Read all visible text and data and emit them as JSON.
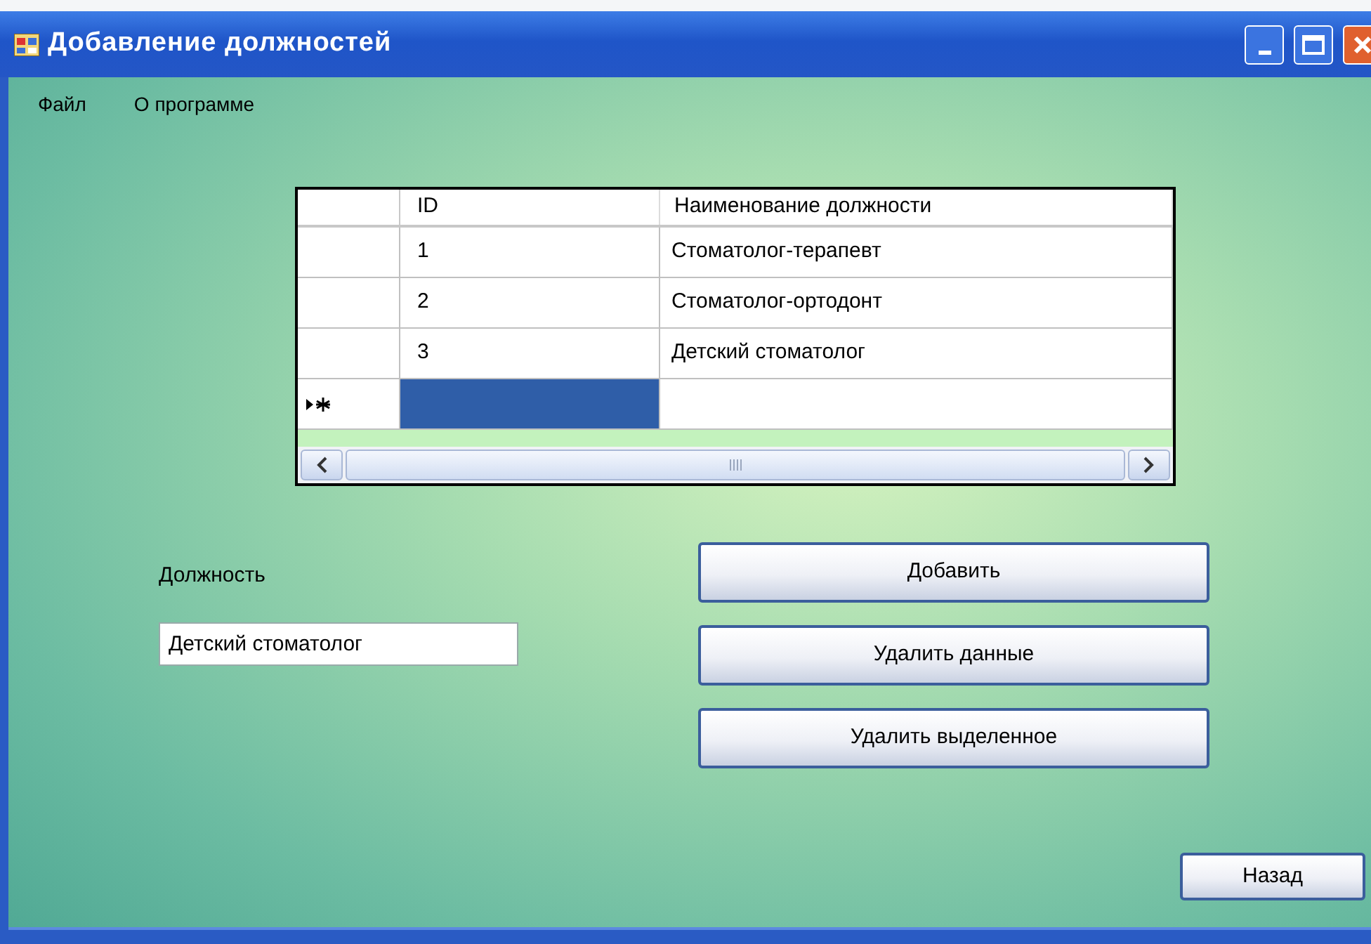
{
  "window": {
    "title": "Добавление должностей"
  },
  "menu": [
    {
      "label": "Файл"
    },
    {
      "label": "О программе"
    }
  ],
  "table": {
    "columns": [
      "ID",
      "Наименование должности"
    ],
    "rows": [
      {
        "new": false,
        "cells": [
          {
            "text": "1",
            "selected": false
          },
          {
            "text": "Стоматолог-терапевт",
            "selected": false
          }
        ]
      },
      {
        "new": false,
        "cells": [
          {
            "text": "2",
            "selected": false
          },
          {
            "text": "Стоматолог-ортодонт",
            "selected": false
          }
        ]
      },
      {
        "new": false,
        "cells": [
          {
            "text": "3",
            "selected": false
          },
          {
            "text": "Детский стоматолог",
            "selected": false
          }
        ]
      },
      {
        "new": true,
        "cells": [
          {
            "selected": true
          },
          {
            "selected": false
          }
        ]
      }
    ]
  },
  "position_label": "Должность",
  "position_field": {
    "value": "Детский стоматолог"
  },
  "buttons": [
    {
      "label": "Добавить"
    },
    {
      "label": "Удалить данные"
    },
    {
      "label": "Удалить выделенное"
    }
  ],
  "back_button": {
    "label": "Назад"
  }
}
